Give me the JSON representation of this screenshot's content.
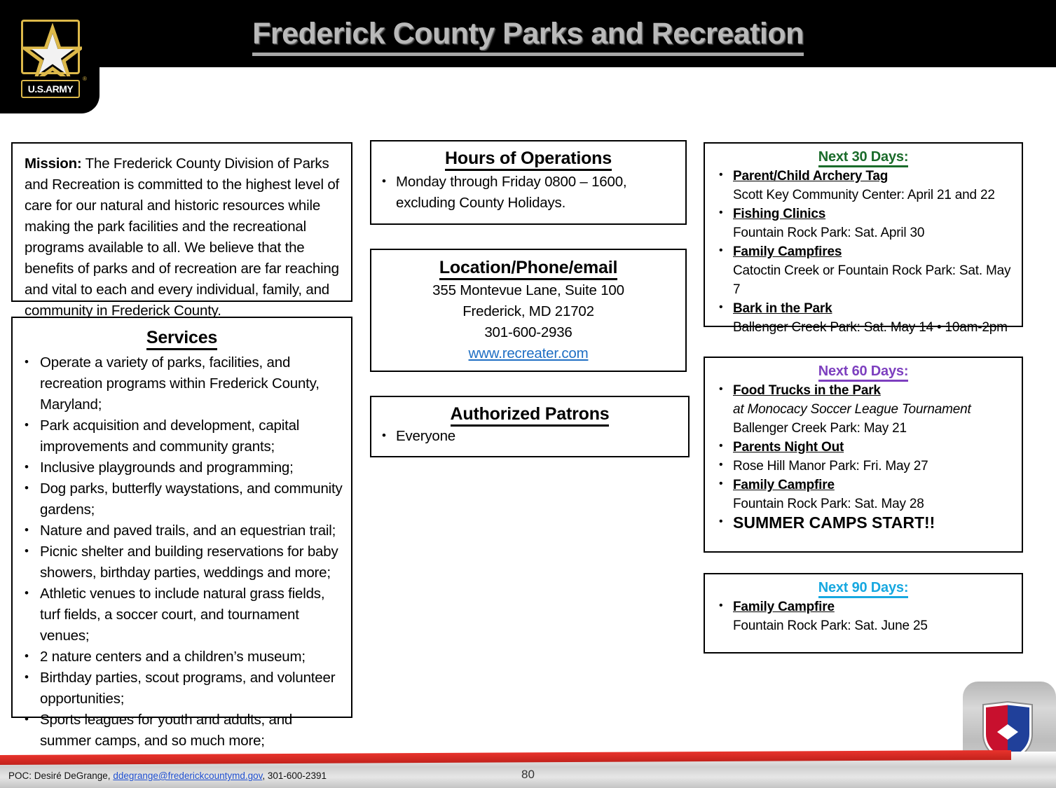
{
  "header": {
    "title": "Frederick County Parks and Recreation",
    "army_logo_label": "U.S.ARMY",
    "army_registered_mark": "®"
  },
  "mission": {
    "label": "Mission:",
    "text": " The Frederick County Division of Parks and Recreation is committed to the highest level of care for our natural and historic resources while making the park facilities and the recreational programs available to all. We believe that the benefits of parks and of recreation are far reaching and vital to each and every individual, family, and community in Frederick County."
  },
  "services": {
    "title": "Services",
    "items": [
      "Operate a variety of parks, facilities, and recreation programs within Frederick County, Maryland;",
      "Park acquisition and development, capital improvements and community grants;",
      "Inclusive playgrounds and programming;",
      "Dog parks, butterfly waystations, and community gardens;",
      "Nature and paved trails, and an equestrian trail;",
      "Picnic shelter and building reservations for baby showers, birthday parties, weddings and more;",
      "Athletic venues to include natural grass fields, turf fields, a soccer court, and tournament venues;",
      "2 nature centers and a children’s museum;",
      "Birthday parties, scout programs, and volunteer opportunities;",
      "Sports leagues for youth and adults, and summer camps, and so much more;"
    ]
  },
  "hours": {
    "title": "Hours of Operations",
    "items": [
      "Monday through Friday 0800 – 1600, excluding County Holidays."
    ]
  },
  "location": {
    "title": "Location/Phone/email",
    "address_line1": "355 Montevue Lane, Suite 100",
    "address_line2": "Frederick, MD 21702",
    "phone": "301-600-2936",
    "website": "www.recreater.com"
  },
  "patrons": {
    "title": "Authorized Patrons",
    "items": [
      "Everyone"
    ]
  },
  "next30": {
    "title": "Next 30 Days:",
    "color": "#1f1fa8",
    "title_color": "#1a6b2a",
    "items": [
      {
        "name": "Parent/Child Archery Tag",
        "detail": "Scott Key Community Center: April 21 and 22"
      },
      {
        "name": "Fishing Clinics",
        "detail": "Fountain Rock Park: Sat. April 30"
      },
      {
        "name": "Family Campfires",
        "detail": "Catoctin Creek or Fountain Rock Park: Sat. May 7"
      },
      {
        "name": "Bark in the Park",
        "detail": "Ballenger Creek Park: Sat. May 14 • 10am-2pm"
      }
    ]
  },
  "next60": {
    "title": "Next 60 Days:",
    "color": "#7d3fbf",
    "items": [
      {
        "name": "Food Trucks in the Park",
        "italic": "at Monocacy Soccer League Tournament",
        "detail": "Ballenger Creek Park: May 21"
      },
      {
        "name": "Parents Night Out",
        "italic": "",
        "detail": ""
      },
      {
        "name": "",
        "italic": "",
        "detail": "Rose Hill Manor Park: Fri. May 27"
      },
      {
        "name": "Family Campfire",
        "italic": "",
        "detail": "Fountain Rock Park: Sat. May 28"
      },
      {
        "name": "",
        "italic": "",
        "detail": "",
        "big": "SUMMER CAMPS START!!"
      }
    ]
  },
  "next90": {
    "title": "Next 90 Days:",
    "color": "#17a8e0",
    "items": [
      {
        "name": "Family Campfire",
        "detail": "Fountain Rock Park: Sat. June 25"
      }
    ]
  },
  "footer": {
    "poc_prefix": "POC: Desiré DeGrange, ",
    "poc_email": "ddegrange@frederickcountymd.gov",
    "poc_suffix": ", 301-600-2391",
    "page_number": "80"
  }
}
